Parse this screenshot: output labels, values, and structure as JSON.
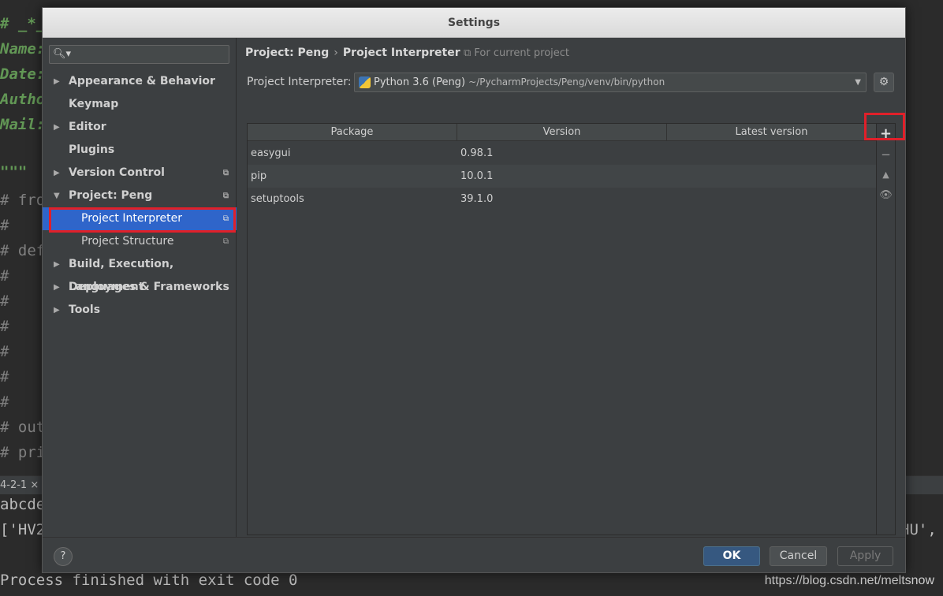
{
  "editor": {
    "lines": [
      {
        "text": "# _*_",
        "green": true
      },
      {
        "text": "Name:",
        "green": true
      },
      {
        "text": "Date:",
        "green": true
      },
      {
        "text": "Autho",
        "green": true
      },
      {
        "text": "Mail:",
        "green": true
      },
      {
        "text": "",
        "green": false
      },
      {
        "text": "\"\"\"",
        "green": true
      },
      {
        "text": "# fro",
        "green": false
      },
      {
        "text": "#",
        "green": false
      },
      {
        "text": "# def",
        "green": false
      },
      {
        "text": "#",
        "green": false
      },
      {
        "text": "#",
        "green": false
      },
      {
        "text": "#",
        "green": false
      },
      {
        "text": "#",
        "green": false
      },
      {
        "text": "#",
        "green": false
      },
      {
        "text": "#",
        "green": false
      },
      {
        "text": "# out",
        "green": false
      },
      {
        "text": "# pri",
        "green": false
      }
    ],
    "run_tab": "4-2-1 ×",
    "output": [
      "abcde",
      "['HV2",
      "",
      "Process finished with exit code 0"
    ],
    "output_right": "HU',",
    "watermark": "https://blog.csdn.net/meltsnow"
  },
  "dialog": {
    "title": "Settings",
    "search_placeholder": "",
    "tree": [
      {
        "label": "Appearance & Behavior",
        "arrow": "▶",
        "copy": "",
        "child": false,
        "selected": false,
        "bold": true
      },
      {
        "label": "Keymap",
        "arrow": "",
        "copy": "",
        "child": false,
        "selected": false,
        "bold": true
      },
      {
        "label": "Editor",
        "arrow": "▶",
        "copy": "",
        "child": false,
        "selected": false,
        "bold": true
      },
      {
        "label": "Plugins",
        "arrow": "",
        "copy": "",
        "child": false,
        "selected": false,
        "bold": true
      },
      {
        "label": "Version Control",
        "arrow": "▶",
        "copy": "⧉",
        "child": false,
        "selected": false,
        "bold": true
      },
      {
        "label": "Project: Peng",
        "arrow": "▼",
        "copy": "⧉",
        "child": false,
        "selected": false,
        "bold": true
      },
      {
        "label": "Project Interpreter",
        "arrow": "",
        "copy": "⧉",
        "child": true,
        "selected": true,
        "bold": false
      },
      {
        "label": "Project Structure",
        "arrow": "",
        "copy": "⧉",
        "child": true,
        "selected": false,
        "bold": false
      },
      {
        "label": "Build, Execution, Deployment",
        "arrow": "▶",
        "copy": "",
        "child": false,
        "selected": false,
        "bold": true
      },
      {
        "label": "Languages & Frameworks",
        "arrow": "▶",
        "copy": "",
        "child": false,
        "selected": false,
        "bold": true
      },
      {
        "label": "Tools",
        "arrow": "▶",
        "copy": "",
        "child": false,
        "selected": false,
        "bold": true
      }
    ],
    "breadcrumb": {
      "project": "Project: Peng",
      "separator": "›",
      "page": "Project Interpreter"
    },
    "for_current_project": "⧉ For current project",
    "interpreter": {
      "label": "Project Interpreter:",
      "name": "Python 3.6 (Peng)",
      "path": "~/PycharmProjects/Peng/venv/bin/python"
    },
    "table": {
      "headers": [
        "Package",
        "Version",
        "Latest version"
      ],
      "rows": [
        {
          "package": "easygui",
          "version": "0.98.1",
          "latest": ""
        },
        {
          "package": "pip",
          "version": "10.0.1",
          "latest": ""
        },
        {
          "package": "setuptools",
          "version": "39.1.0",
          "latest": ""
        }
      ]
    },
    "tools": {
      "add": "+",
      "remove": "−",
      "upgrade": "▲",
      "show": "👁"
    },
    "footer": {
      "help": "?",
      "ok": "OK",
      "cancel": "Cancel",
      "apply": "Apply"
    },
    "accent": "#2f65ca",
    "highlight_color": "#e0202a"
  }
}
